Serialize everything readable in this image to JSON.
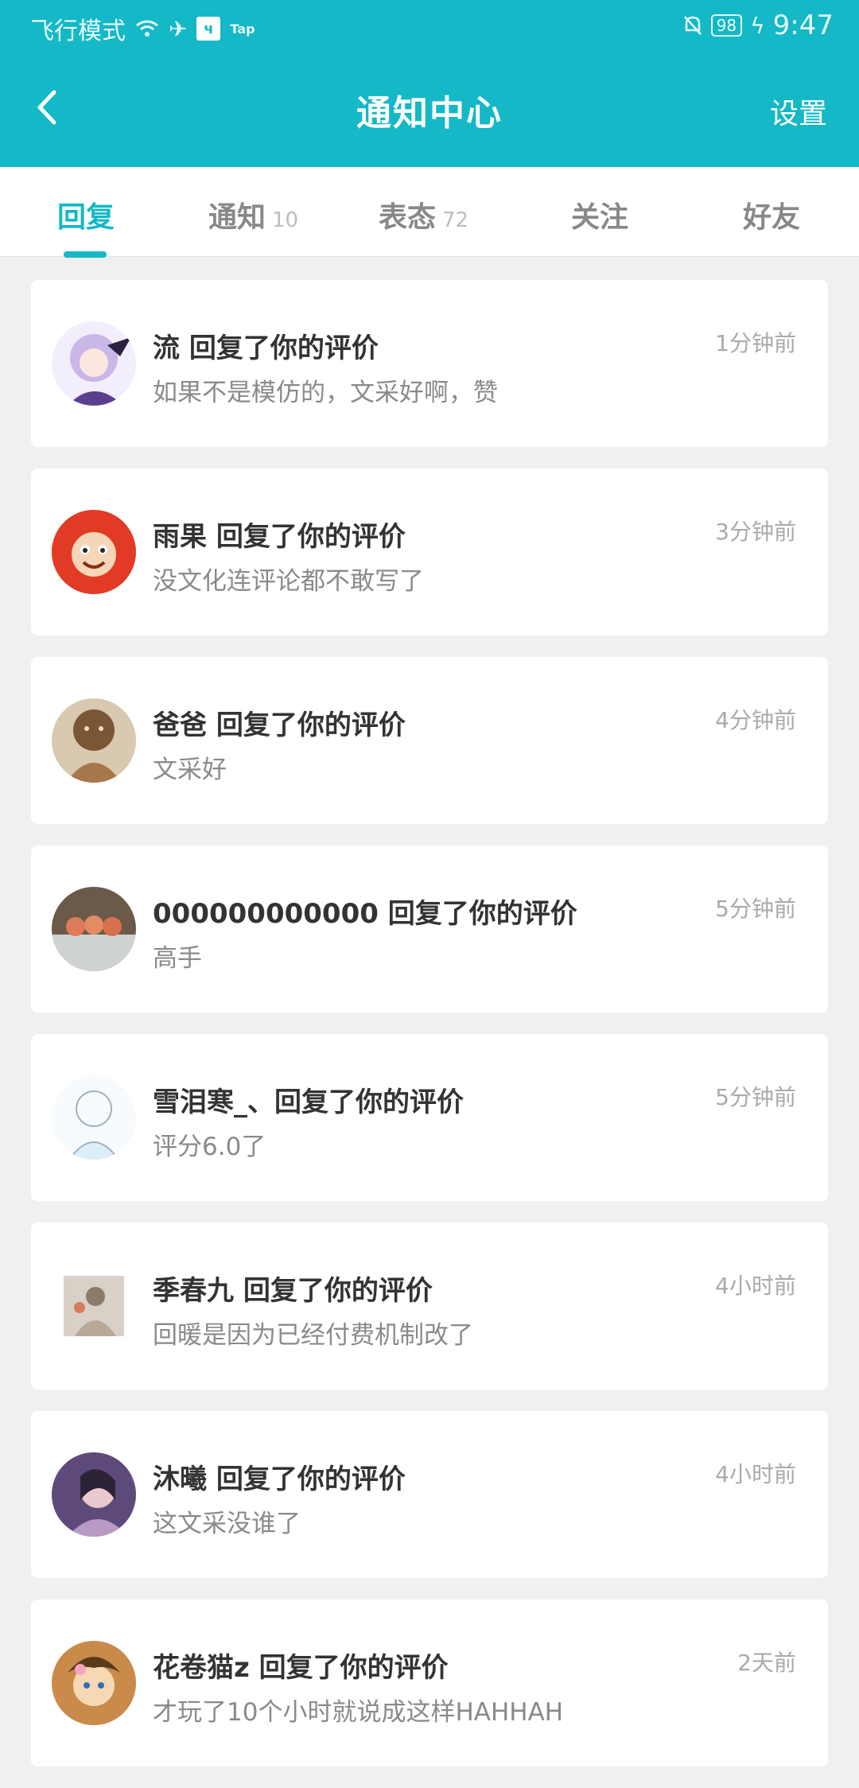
{
  "status_bar": {
    "mode": "飞行模式",
    "tap": "Tap",
    "battery": "98",
    "time": "9:47"
  },
  "header": {
    "title": "通知中心",
    "settings": "设置"
  },
  "tabs": [
    {
      "label": "回复",
      "count": ""
    },
    {
      "label": "通知",
      "count": "10"
    },
    {
      "label": "表态",
      "count": "72"
    },
    {
      "label": "关注",
      "count": ""
    },
    {
      "label": "好友",
      "count": ""
    }
  ],
  "active_tab": "回复",
  "colors": {
    "accent": "#14b8c6",
    "background": "#f0f0f0"
  },
  "items": [
    {
      "title": "流 回复了你的评价",
      "body": "如果不是模仿的，文采好啊，赞",
      "time": "1分钟前",
      "avatar": "anime-girl-avatar"
    },
    {
      "title": "雨果 回复了你的评价",
      "body": "没文化连评论都不敢写了",
      "time": "3分钟前",
      "avatar": "monkey-avatar"
    },
    {
      "title": "爸爸 回复了你的评价",
      "body": "文采好",
      "time": "4分钟前",
      "avatar": "beast-avatar"
    },
    {
      "title": "000000000000 回复了你的评价",
      "body": "高手",
      "time": "5分钟前",
      "avatar": "food-avatar"
    },
    {
      "title": "雪泪寒_、回复了你的评价",
      "body": "评分6.0了",
      "time": "5分钟前",
      "avatar": "sketch-avatar"
    },
    {
      "title": "季春九 回复了你的评价",
      "body": "回暖是因为已经付费机制改了",
      "time": "4小时前",
      "avatar": "drawing-avatar"
    },
    {
      "title": "沐曦 回复了你的评价",
      "body": "这文采没谁了",
      "time": "4小时前",
      "avatar": "photo-avatar"
    },
    {
      "title": "花卷猫z 回复了你的评价",
      "body": "才玩了10个小时就说成这样HAHHAH",
      "time": "2天前",
      "avatar": "cartoon-avatar"
    }
  ]
}
